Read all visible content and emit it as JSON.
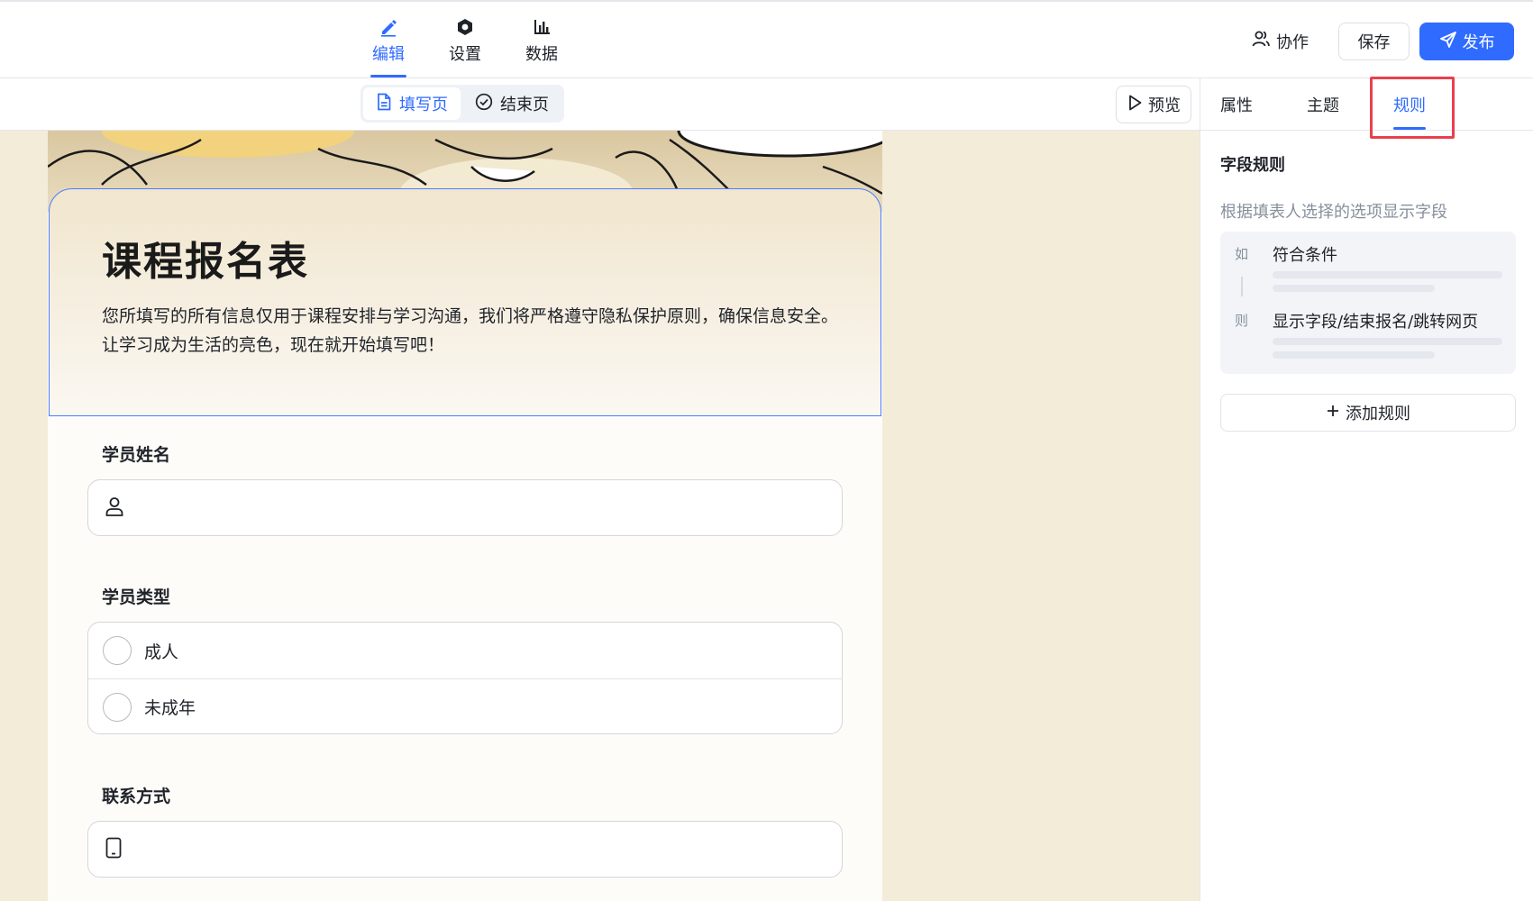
{
  "top_nav": {
    "tabs": [
      {
        "label": "编辑",
        "icon": "pen-icon",
        "active": true
      },
      {
        "label": "设置",
        "icon": "gear-icon",
        "active": false
      },
      {
        "label": "数据",
        "icon": "bar-chart-icon",
        "active": false
      }
    ],
    "collab_label": "协作",
    "save_label": "保存",
    "publish_label": "发布"
  },
  "sub_bar": {
    "segments": [
      {
        "label": "填写页",
        "icon": "document-icon",
        "active": true
      },
      {
        "label": "结束页",
        "icon": "check-circle-icon",
        "active": false
      }
    ],
    "preview_label": "预览"
  },
  "form": {
    "title": "课程报名表",
    "description": "您所填写的所有信息仅用于课程安排与学习沟通，我们将严格遵守隐私保护原则，确保信息安全。让学习成为生活的亮色，现在就开始填写吧！",
    "fields": [
      {
        "label": "学员姓名",
        "type": "text",
        "icon": "person-icon"
      },
      {
        "label": "学员类型",
        "type": "radio",
        "options": [
          "成人",
          "未成年"
        ]
      },
      {
        "label": "联系方式",
        "type": "text",
        "icon": "phone-icon"
      }
    ]
  },
  "right_panel": {
    "tabs": [
      {
        "label": "属性",
        "active": false
      },
      {
        "label": "主题",
        "active": false
      },
      {
        "label": "规则",
        "active": true
      }
    ],
    "section_title": "字段规则",
    "section_desc": "根据填表人选择的选项显示字段",
    "rule": {
      "if_key": "如",
      "if_text": "符合条件",
      "then_key": "则",
      "then_text": "显示字段/结束报名/跳转网页"
    },
    "add_rule_label": "添加规则"
  },
  "colors": {
    "accent": "#2f6bff",
    "highlight": "#e8414c",
    "canvas_bg": "#f3ecd9"
  }
}
